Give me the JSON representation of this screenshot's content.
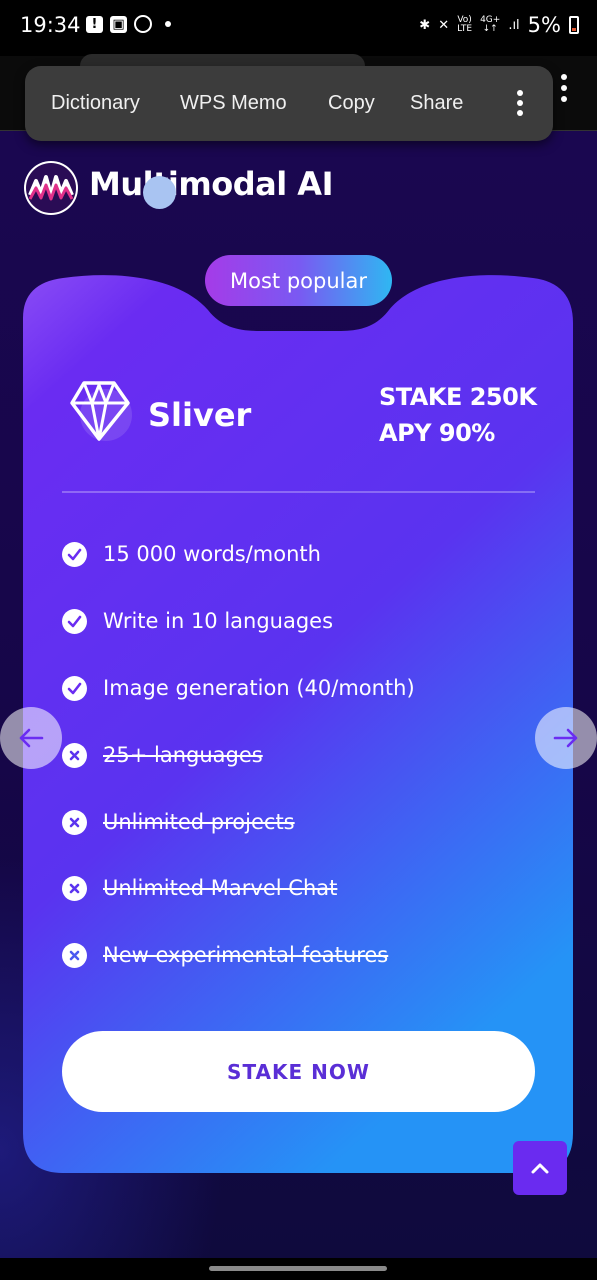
{
  "status_bar": {
    "time": "19:34",
    "network": "4G+",
    "volte_top": "Vo)",
    "volte_bottom": "LTE",
    "battery": "5%"
  },
  "context_menu": {
    "items": [
      "Dictionary",
      "WPS Memo",
      "Copy",
      "Share"
    ]
  },
  "header": {
    "brand_name": "Multimodal AI"
  },
  "plan": {
    "badge": "Most popular",
    "name": "Sliver",
    "stake": "STAKE 250K",
    "apy": "APY 90%",
    "features": [
      {
        "text": "15 000 words/month",
        "included": true
      },
      {
        "text": "Write in 10 languages",
        "included": true
      },
      {
        "text": "Image generation (40/month)",
        "included": true
      },
      {
        "text": "25+ languages",
        "included": false
      },
      {
        "text": "Unlimited projects",
        "included": false
      },
      {
        "text": "Unlimited Marvel Chat",
        "included": false
      },
      {
        "text": "New experimental features",
        "included": false
      }
    ],
    "cta": "STAKE NOW"
  },
  "colors": {
    "accent": "#6a2bf0",
    "cta_text": "#5a2ed6",
    "card_top": "#6b2cf2",
    "card_bottom": "#2a8cf5"
  },
  "icons": {
    "included": "check-circle-icon",
    "excluded": "x-circle-icon",
    "prev": "arrow-left-icon",
    "next": "arrow-right-icon",
    "scroll": "chevron-up-icon"
  }
}
